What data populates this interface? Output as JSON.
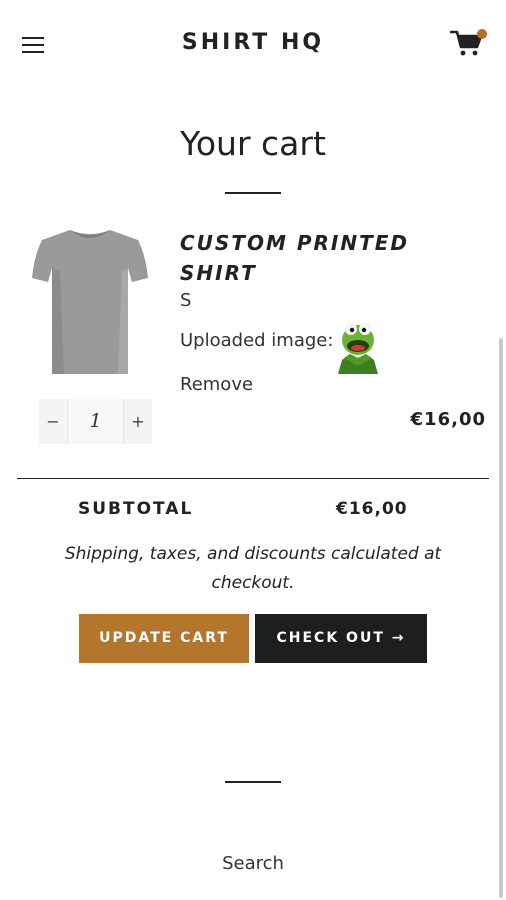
{
  "header": {
    "brand": "SHIRT HQ",
    "menu_icon": "hamburger-menu-icon",
    "cart_icon": "shopping-cart-icon",
    "accent_color": "#b07229"
  },
  "cart": {
    "title": "Your cart",
    "item": {
      "title": "CUSTOM PRINTED SHIRT",
      "variant": "S",
      "uploaded_label": "Uploaded image:",
      "remove_label": "Remove",
      "quantity": "1",
      "qty_minus": "−",
      "qty_plus": "+",
      "price": "€16,00"
    },
    "subtotal_label": "SUBTOTAL",
    "subtotal_value": "€16,00",
    "note": "Shipping, taxes, and discounts calculated at checkout.",
    "update_label": "UPDATE CART",
    "checkout_label": "CHECK OUT →"
  },
  "footer": {
    "search_label": "Search"
  },
  "colors": {
    "update_button": "#b3762c",
    "checkout_button": "#1e1e1e"
  }
}
